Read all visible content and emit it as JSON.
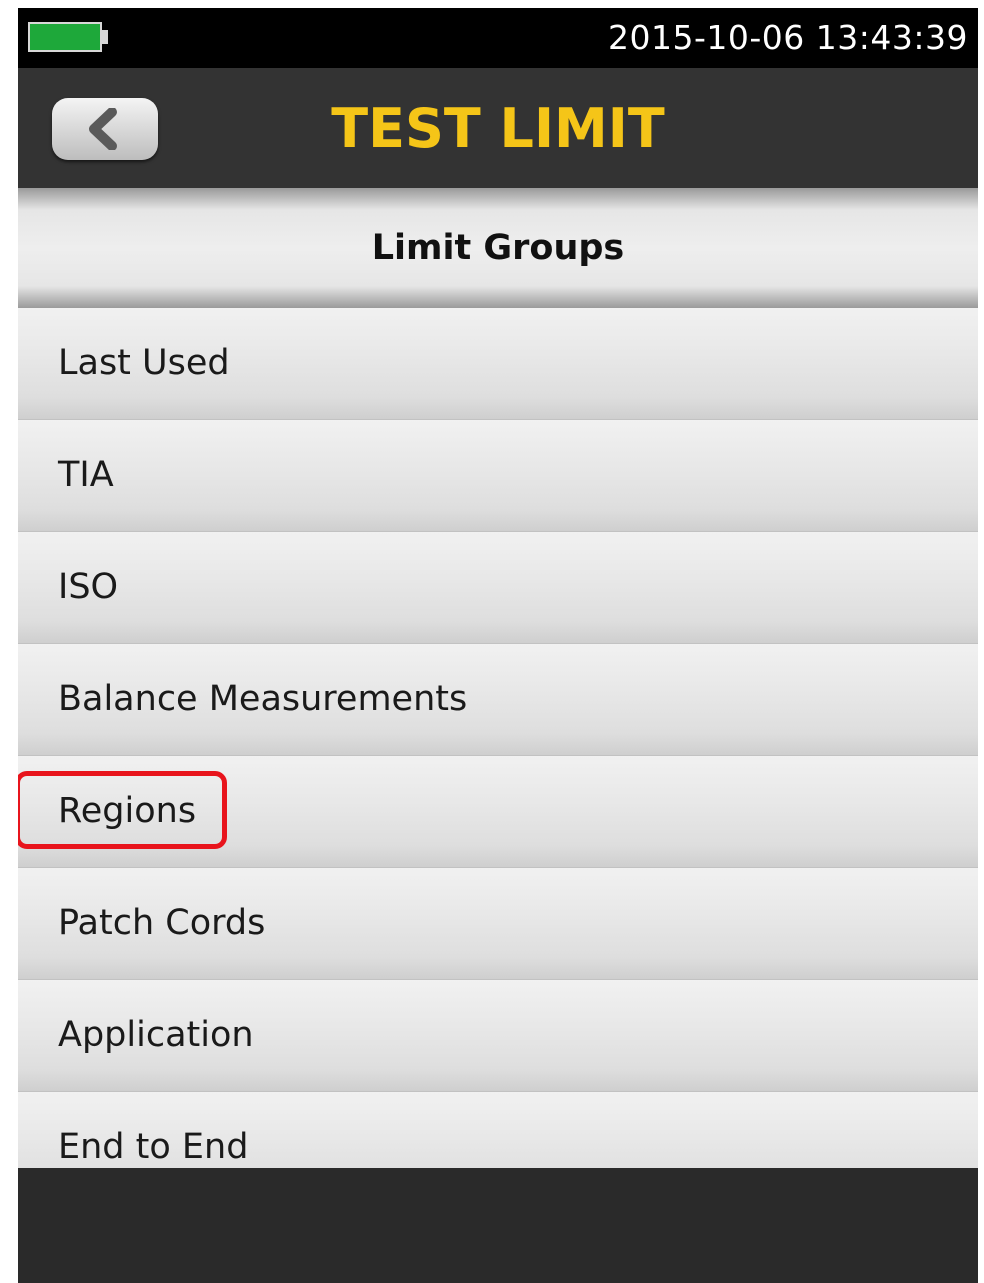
{
  "status_bar": {
    "datetime": "2015-10-06 13:43:39",
    "battery_color": "#1ea83a"
  },
  "header": {
    "title": "TEST LIMIT",
    "back_icon": "chevron-left-icon",
    "title_color": "#f5c518"
  },
  "section": {
    "title": "Limit Groups"
  },
  "list": {
    "items": [
      {
        "label": "Last Used"
      },
      {
        "label": "TIA"
      },
      {
        "label": "ISO"
      },
      {
        "label": "Balance Measurements"
      },
      {
        "label": "Regions",
        "highlighted": true
      },
      {
        "label": "Patch Cords"
      },
      {
        "label": "Application"
      },
      {
        "label": "End to End"
      }
    ],
    "highlight_color": "#e8141c"
  }
}
